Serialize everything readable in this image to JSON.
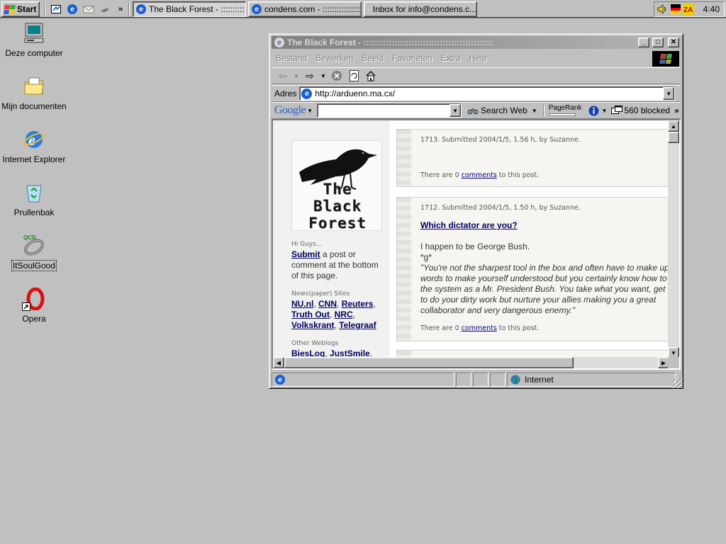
{
  "taskbar": {
    "start_label": "Start",
    "tasks": [
      {
        "label": "The Black Forest - ::::::::::::::"
      },
      {
        "label": "condens.com - ::::::::::::::::::::::"
      },
      {
        "label": "Inbox for info@condens.c..."
      }
    ],
    "quick_launch_more": "»",
    "clock": "4:40"
  },
  "desktop": {
    "icons": [
      {
        "label": "Deze computer",
        "icon": "my-computer-icon"
      },
      {
        "label": "Mijn documenten",
        "icon": "my-documents-icon"
      },
      {
        "label": "Internet Explorer",
        "icon": "internet-explorer-icon"
      },
      {
        "label": "Prullenbak",
        "icon": "recycle-bin-icon"
      },
      {
        "label": "ItSoulGood",
        "icon": "qcd-icon"
      },
      {
        "label": "Opera",
        "icon": "opera-icon"
      }
    ]
  },
  "browser": {
    "title": "The Black Forest - ::::::::::::::::::::::::::::::::::::::::::::::",
    "menu": [
      "Bestand",
      "Bewerken",
      "Beeld",
      "Favorieten",
      "Extra",
      "Help"
    ],
    "address_label": "Adres",
    "address_value": "http://arduenn.ma.cx/",
    "google": {
      "logo": "Google",
      "search_web_label": "Search Web",
      "pagerank_label": "PageRank",
      "blocked_label": "560 blocked",
      "more": "»"
    },
    "status": {
      "zone_label": "Internet"
    }
  },
  "page": {
    "logo_lines": [
      "The",
      "Black",
      "Forest"
    ],
    "greeting": "Hi Guys...",
    "submit_link": "Submit",
    "submit_text": " a post or comment at the bottom of this page.",
    "news_heading": "News(paper) Sites",
    "news_links": [
      "NU.nl",
      "CNN",
      "Reuters",
      "Truth Out",
      "NRC",
      "Volkskrant",
      "Telegraaf"
    ],
    "weblogs_heading": "Other Weblogs",
    "weblog_links": [
      "BiesLog",
      "JustSmile"
    ],
    "posts": [
      {
        "meta": "1713.  Submitted 2004/1/5, 1.56 h, by Suzanne.",
        "foot_pre": "There are 0 ",
        "foot_link": "comments",
        "foot_post": " to this post."
      },
      {
        "meta": "1712.  Submitted 2004/1/5, 1.50 h, by Suzanne.",
        "title": "Which dictator are you?",
        "line1": "I happen to be George Bush.",
        "line2": "*g*",
        "quote": "\"You're not the sharpest tool in the box and often have to make up words to make yourself understood but you certainly know how to the system as a Mr. President Bush. You take what you want, get p to do your dirty work but nurture your allies making you a great collaborator and very dangerous enemy.\"",
        "foot_pre": "There are 0 ",
        "foot_link": "comments",
        "foot_post": " to this post."
      }
    ]
  },
  "colors": {
    "desktop": "#c0c0c0",
    "link": "#000060",
    "sidebar": "#f1f1f0",
    "post_bg": "#f6f5f1"
  }
}
